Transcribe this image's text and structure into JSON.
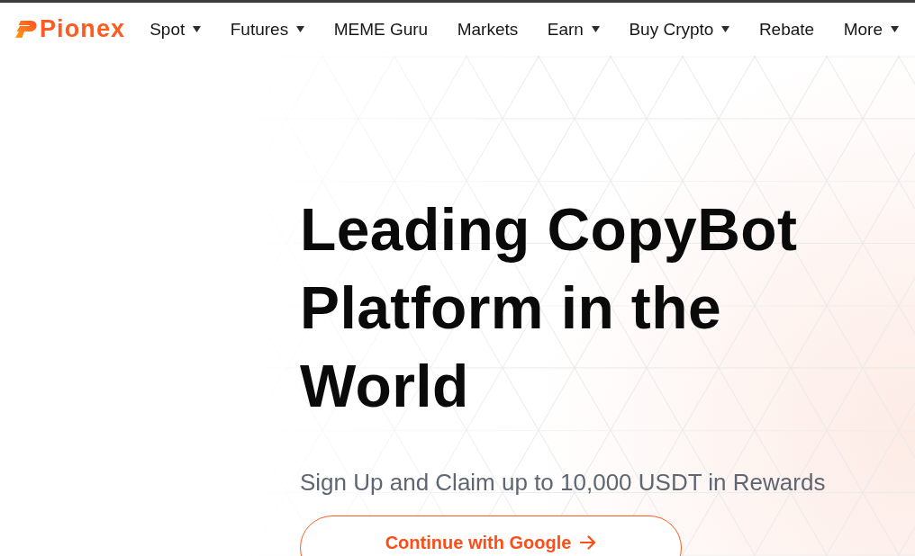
{
  "header": {
    "logo": {
      "text": "Pionex"
    },
    "nav_items": [
      {
        "label": "Spot",
        "kind": "dropdown"
      },
      {
        "label": "Futures",
        "kind": "dropdown"
      },
      {
        "label": "MEME Guru",
        "kind": "link"
      },
      {
        "label": "Markets",
        "kind": "link"
      },
      {
        "label": "Earn",
        "kind": "dropdown"
      },
      {
        "label": "Buy Crypto",
        "kind": "dropdown"
      },
      {
        "label": "Rebate",
        "kind": "link"
      },
      {
        "label": "More",
        "kind": "dropdown"
      }
    ]
  },
  "hero": {
    "title": "Leading CopyBot\nPlatform in the\nWorld",
    "subtitle": "Sign Up and Claim up to 10,000 USDT in Rewards",
    "cta_button": {
      "label": "Continue with Google"
    }
  }
}
